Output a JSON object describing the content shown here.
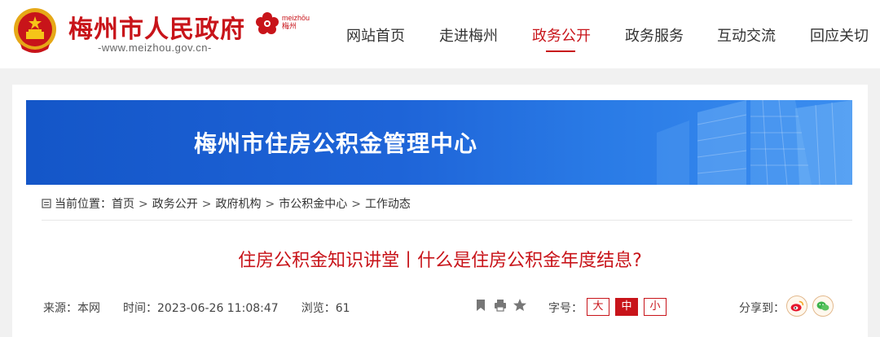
{
  "header": {
    "site_title": "梅州市人民政府",
    "site_domain": "-www.meizhou.gov.cn-",
    "brand_sub": "meizhōu",
    "brand_sub2": "梅州",
    "nav": [
      {
        "label": "网站首页",
        "active": false
      },
      {
        "label": "走进梅州",
        "active": false
      },
      {
        "label": "政务公开",
        "active": true
      },
      {
        "label": "政务服务",
        "active": false
      },
      {
        "label": "互动交流",
        "active": false
      },
      {
        "label": "回应关切",
        "active": false
      }
    ]
  },
  "banner": {
    "title": "梅州市住房公积金管理中心"
  },
  "breadcrumb": {
    "prefix": "当前位置：",
    "items": [
      "首页",
      "政务公开",
      "政府机构",
      "市公积金中心",
      "工作动态"
    ],
    "separator": ">"
  },
  "article": {
    "title": "住房公积金知识讲堂丨什么是住房公积金年度结息?",
    "source_label": "来源：",
    "source_value": "本网",
    "time_label": "时间：",
    "time_value": "2023-06-26 11:08:47",
    "views_label": "浏览：",
    "views_value": "61"
  },
  "tools": {
    "icons": [
      "bookmark-icon",
      "print-icon",
      "star-icon"
    ],
    "font_size_label": "字号：",
    "font_sizes": [
      {
        "label": "大",
        "active": false
      },
      {
        "label": "中",
        "active": true
      },
      {
        "label": "小",
        "active": false
      }
    ],
    "share_label": "分享到：",
    "share_icons": [
      "weibo-icon",
      "wechat-icon"
    ]
  },
  "colors": {
    "brand_red": "#c8141a",
    "banner_blue": "#1e64d8",
    "background": "#f1f1f1"
  }
}
